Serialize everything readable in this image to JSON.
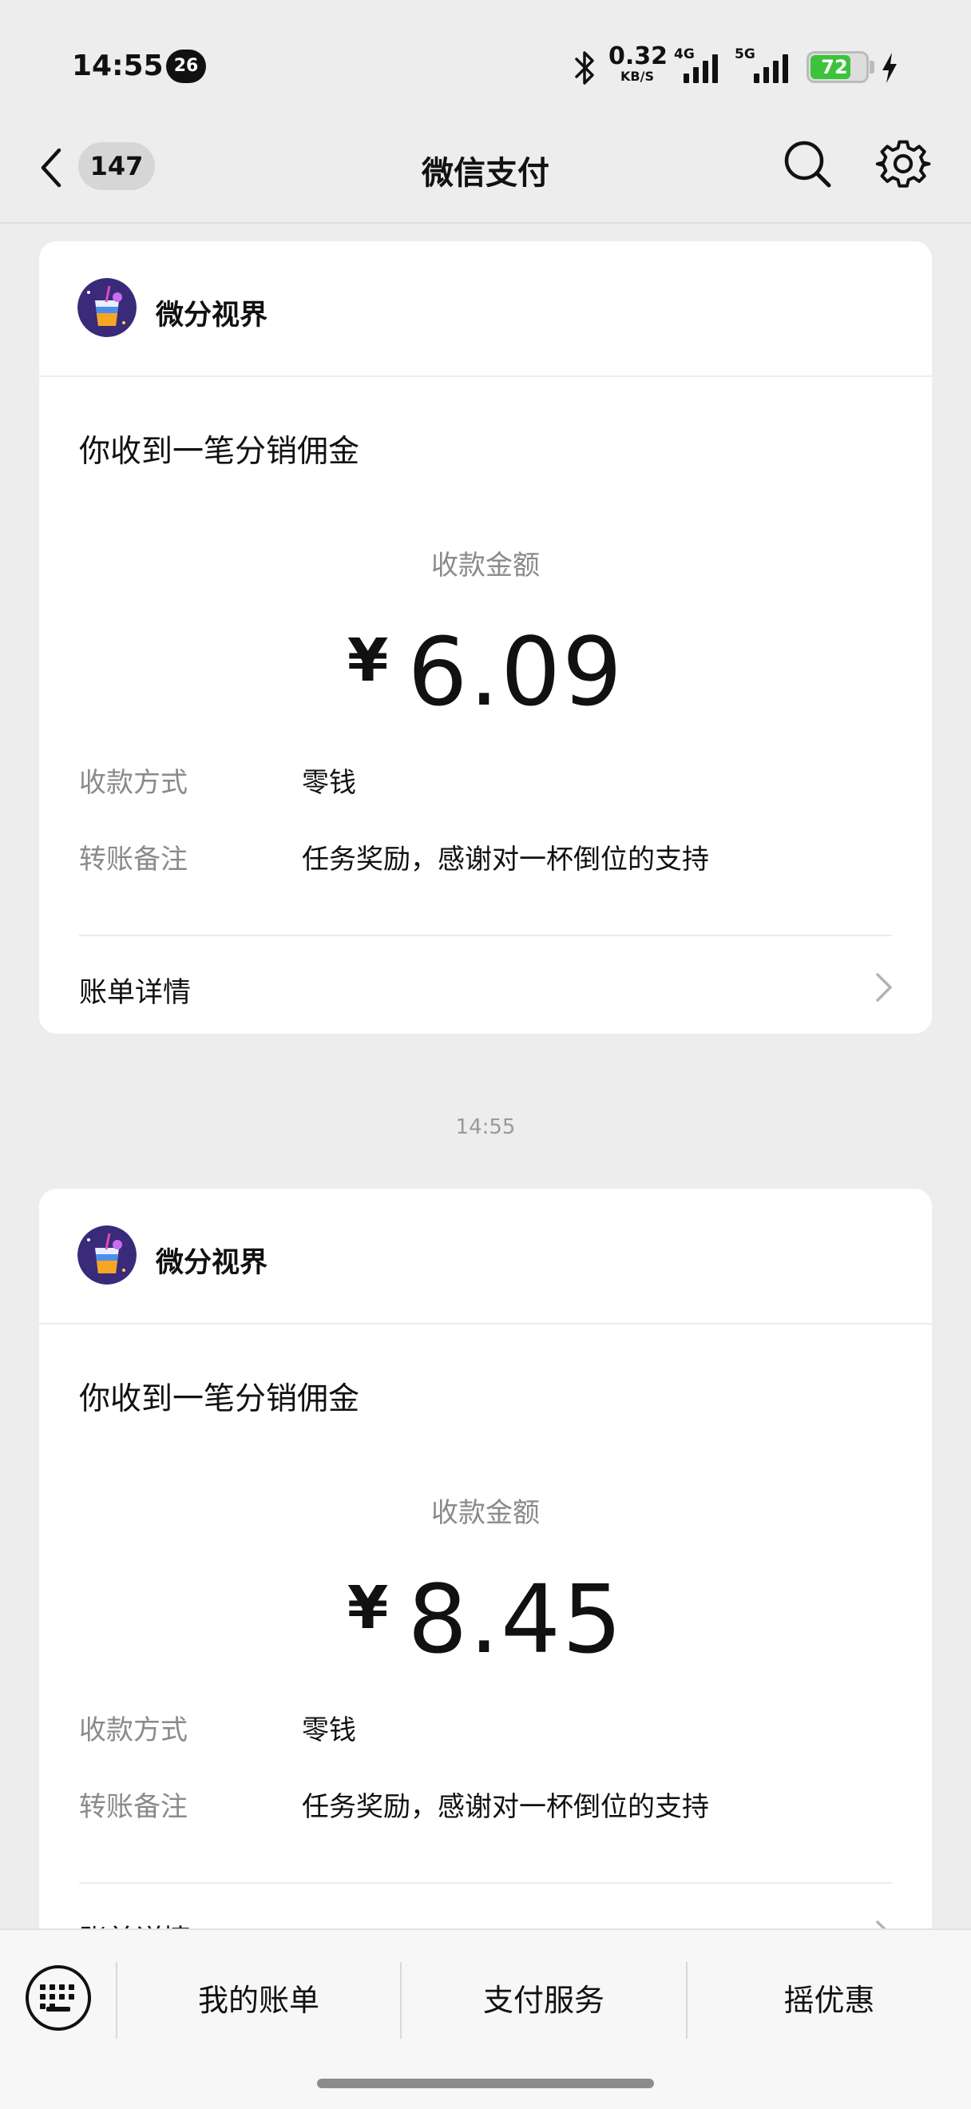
{
  "status_bar": {
    "time": "14:55",
    "notification_count": "26",
    "net_speed_value": "0.32",
    "net_speed_unit": "KB/S",
    "signal_1_tag": "4G",
    "signal_2_tag": "5G",
    "battery_level": "72",
    "battery_percent": 0.72,
    "battery_color": "#3cc23c"
  },
  "nav": {
    "unread_count": "147",
    "title": "微信支付",
    "icons": [
      "back-arrow-icon",
      "search-icon",
      "gear-icon"
    ]
  },
  "messages": [
    {
      "merchant": "微分视界",
      "title": "你收到一笔分销佣金",
      "amount_label": "收款金额",
      "currency": "¥",
      "amount": "6.09",
      "method_label": "收款方式",
      "method_value": "零钱",
      "note_label": "转账备注",
      "note_value": "任务奖励，感谢对一杯倒位的支持",
      "detail_label": "账单详情"
    },
    {
      "merchant": "微分视界",
      "title": "你收到一笔分销佣金",
      "amount_label": "收款金额",
      "currency": "¥",
      "amount": "8.45",
      "method_label": "收款方式",
      "method_value": "零钱",
      "note_label": "转账备注",
      "note_value": "任务奖励，感谢对一杯倒位的支持",
      "detail_label": "账单详情"
    }
  ],
  "timestamp": "14:55",
  "bottom_bar": {
    "keyboard_icon": "keyboard-icon",
    "tabs": [
      "我的账单",
      "支付服务",
      "摇优惠"
    ]
  }
}
